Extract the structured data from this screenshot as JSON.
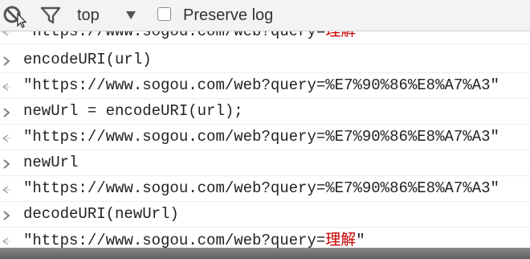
{
  "toolbar": {
    "clear_icon": "clear-console-icon",
    "filter_icon": "filter-icon",
    "context": "top",
    "context_arrow_icon": "dropdown-triangle-icon",
    "preserve_log_label": "Preserve log",
    "preserve_log_checked": false
  },
  "console": {
    "rows": [
      {
        "kind": "output",
        "text": "\"https://www.sogou.com/web?query=",
        "cjk": "理解",
        "tail": ""
      },
      {
        "kind": "input",
        "text": "encodeURI(url)"
      },
      {
        "kind": "output",
        "text": "\"https://www.sogou.com/web?query=%E7%90%86%E8%A7%A3\""
      },
      {
        "kind": "input",
        "text": "newUrl = encodeURI(url);"
      },
      {
        "kind": "output",
        "text": "\"https://www.sogou.com/web?query=%E7%90%86%E8%A7%A3\""
      },
      {
        "kind": "input",
        "text": "newUrl"
      },
      {
        "kind": "output",
        "text": "\"https://www.sogou.com/web?query=%E7%90%86%E8%A7%A3\""
      },
      {
        "kind": "input",
        "text": "decodeURI(newUrl)"
      },
      {
        "kind": "output",
        "text": "\"https://www.sogou.com/web?query=",
        "cjk": "理解",
        "tail": "\""
      }
    ],
    "input_prompt_icon": "chevron-right-icon",
    "output_prompt_icon": "return-arrow-icon"
  },
  "colors": {
    "toolbar_bg": "#f3f3f3",
    "text": "#222222",
    "cjk_text": "#c80000",
    "prompt": "#9a9a9a"
  }
}
